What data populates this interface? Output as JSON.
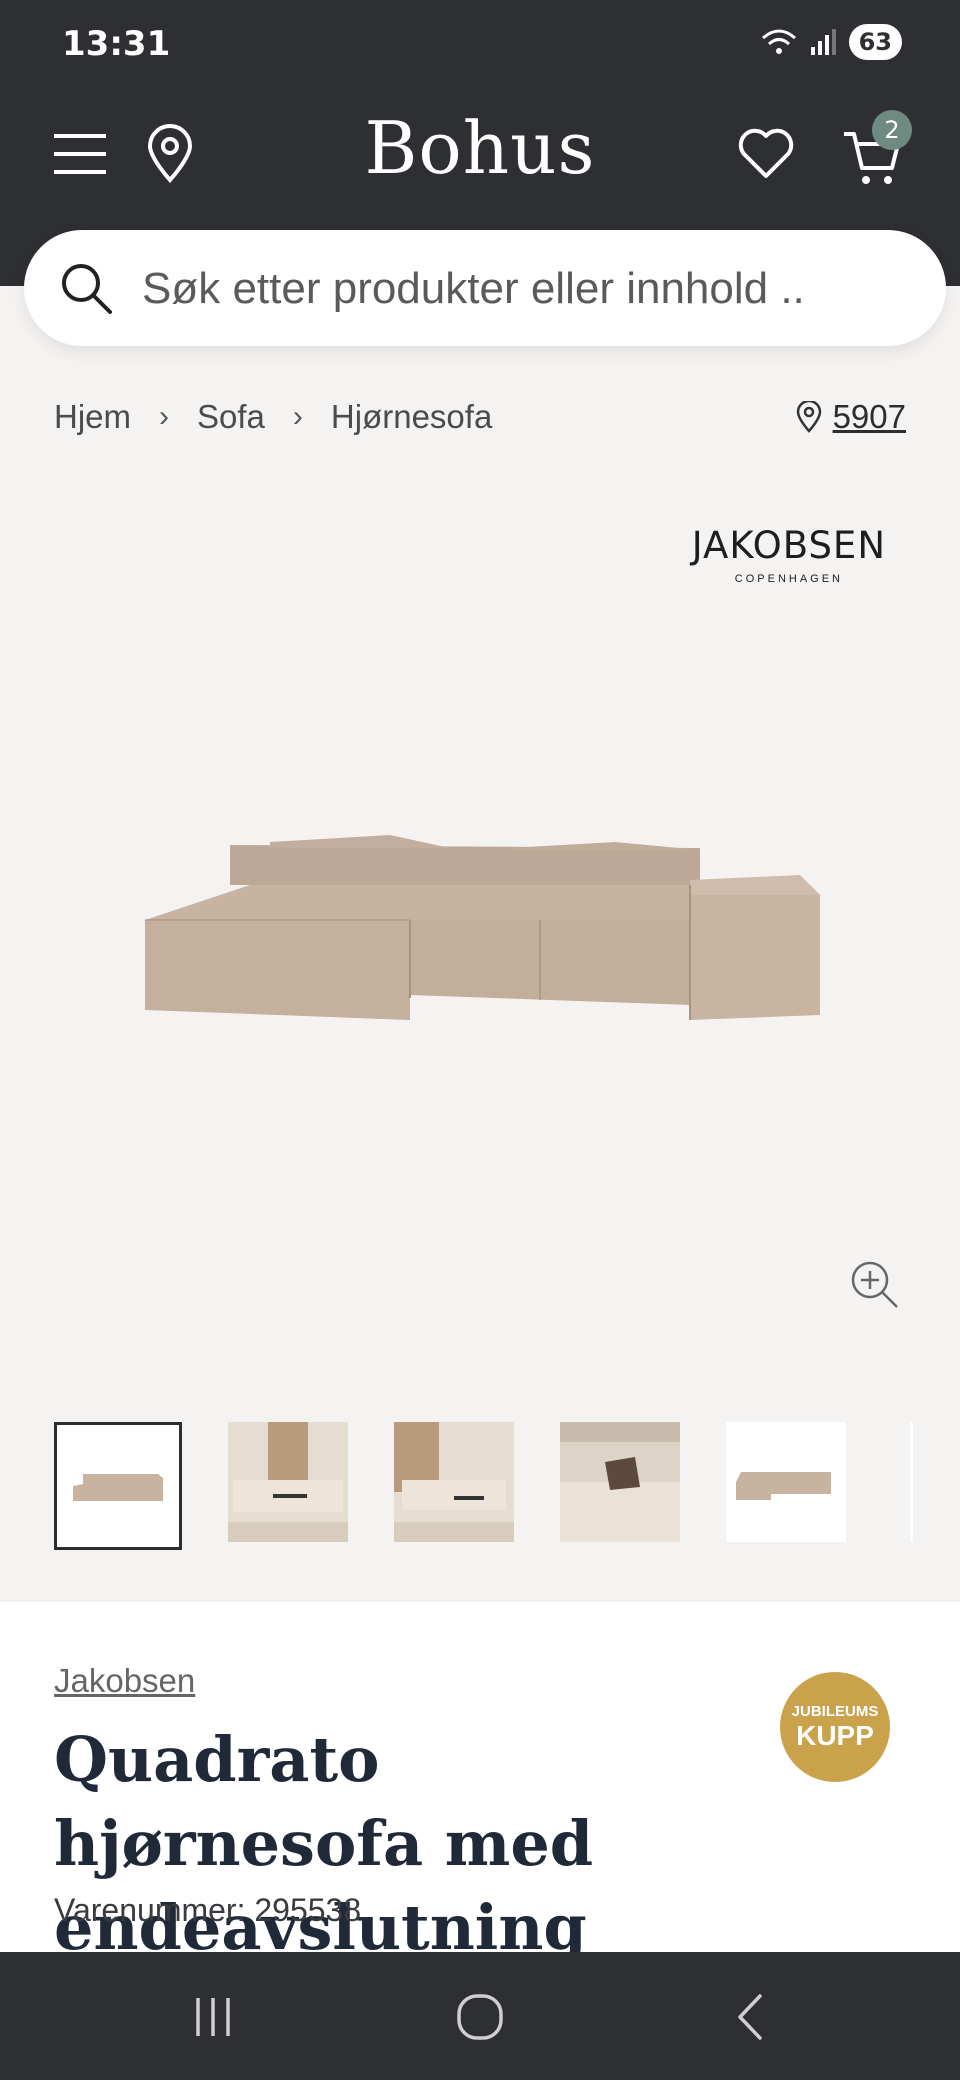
{
  "status_bar": {
    "time": "13:31",
    "battery": "63"
  },
  "header": {
    "logo": "Bohus",
    "cart_count": "2"
  },
  "search": {
    "placeholder": "Søk etter produkter eller innhold .."
  },
  "breadcrumb": [
    "Hjem",
    "Sofa",
    "Hjørnesofa"
  ],
  "store": {
    "number": "5907"
  },
  "brand_logo": {
    "name": "JAKOBSEN",
    "sub": "COPENHAGEN"
  },
  "product": {
    "brand": "Jakobsen",
    "title": "Quadrato hjørnesofa med endeavslutning",
    "sku_label": "Varenummer: 295538",
    "badge_top": "JUBILEUMS",
    "badge_bottom": "KUPP"
  },
  "colors": {
    "header_bg": "#2e2f33",
    "sofa": "#c8b3a1",
    "badge": "#c9a24b",
    "cart_badge": "#6f8a80"
  },
  "icons": [
    "menu-icon",
    "location-pin-icon",
    "heart-icon",
    "cart-icon",
    "search-icon",
    "zoom-in-icon",
    "recent-apps-icon",
    "home-icon",
    "back-icon"
  ]
}
